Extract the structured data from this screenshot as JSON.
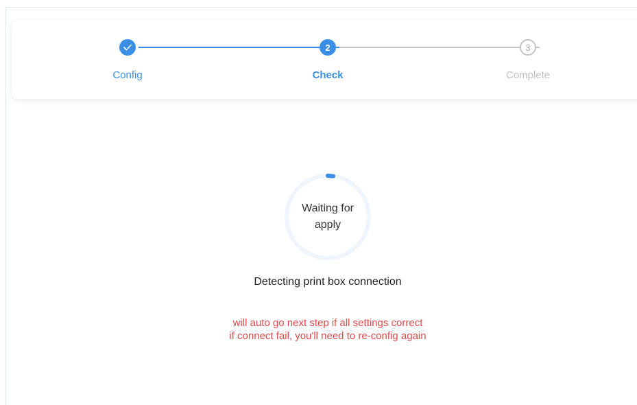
{
  "steps": [
    {
      "label": "Config",
      "number": "1",
      "state": "done",
      "icon": "check-icon"
    },
    {
      "label": "Check",
      "number": "2",
      "state": "active"
    },
    {
      "label": "Complete",
      "number": "3",
      "state": "todo"
    }
  ],
  "progress": {
    "text_line1": "Waiting for",
    "text_line2": "apply"
  },
  "status": "Detecting print box connection",
  "warning": {
    "line1": "will auto go next step if all settings correct",
    "line2": "if connect fail, you'll need to re-config again"
  },
  "colors": {
    "accent": "#3a8ee6",
    "inactive": "#c4c4c4",
    "warning": "#e04a4a"
  }
}
